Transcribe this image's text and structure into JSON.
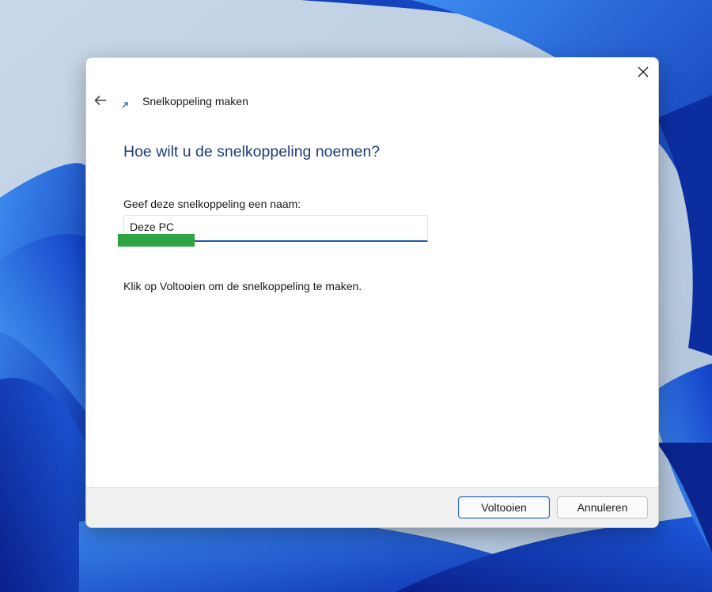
{
  "wizard": {
    "title": "Snelkoppeling maken",
    "heading": "Hoe wilt u de snelkoppeling noemen?",
    "name_label": "Geef deze snelkoppeling een naam:",
    "name_value": "Deze PC",
    "info": "Klik op Voltooien om de snelkoppeling te maken."
  },
  "buttons": {
    "finish": "Voltooien",
    "cancel": "Annuleren"
  },
  "icons": {
    "back": "back-arrow-icon",
    "close": "close-icon",
    "wizard": "shortcut-icon"
  },
  "colors": {
    "heading": "#1f3d7a",
    "input_underline": "#1f5ba8",
    "highlight": "#2ea443",
    "accent_button_border": "#2a68b3",
    "wallpaper_blue": "#1f4fd6"
  }
}
